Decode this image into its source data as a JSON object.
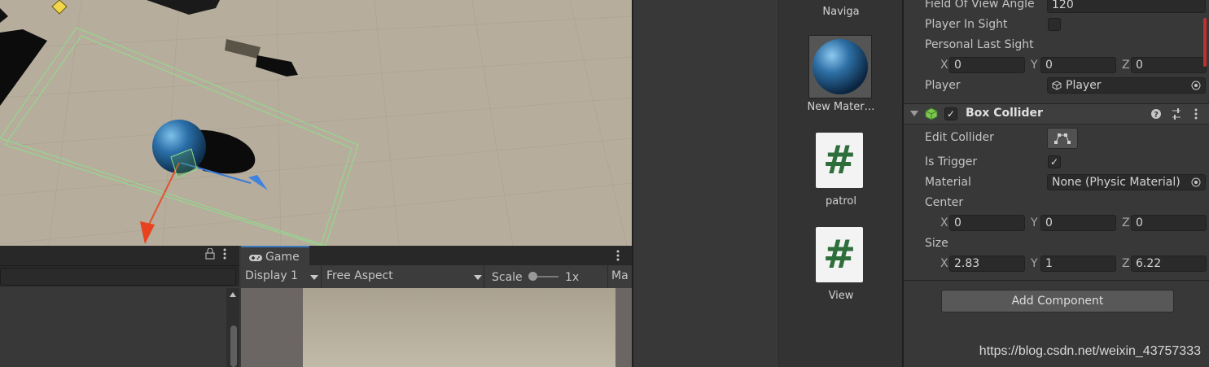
{
  "game_panel": {
    "tab_label": "Game",
    "display": "Display 1",
    "aspect": "Free Aspect",
    "scale_label": "Scale",
    "scale_value": "1x",
    "maximize_truncated": "Ma"
  },
  "project": {
    "assets": [
      {
        "name": "Naviga"
      },
      {
        "name": "New Mater…"
      },
      {
        "name": "patrol",
        "glyph": "#"
      },
      {
        "name": "View",
        "glyph": "#"
      }
    ]
  },
  "inspector": {
    "fov_label": "Field Of View Angle",
    "fov_value": "120",
    "player_in_sight_label": "Player In Sight",
    "personal_last_sight_label": "Personal Last Sight",
    "pls": {
      "x_label": "X",
      "x": "0",
      "y_label": "Y",
      "y": "0",
      "z_label": "Z",
      "z": "0"
    },
    "player_label": "Player",
    "player_value": "Player",
    "component_title": "Box Collider",
    "edit_collider_label": "Edit Collider",
    "is_trigger_label": "Is Trigger",
    "is_trigger_checked": true,
    "material_label": "Material",
    "material_value": "None (Physic Material)",
    "center_label": "Center",
    "center": {
      "x_label": "X",
      "x": "0",
      "y_label": "Y",
      "y": "0",
      "z_label": "Z",
      "z": "0"
    },
    "size_label": "Size",
    "size": {
      "x_label": "X",
      "x": "2.83",
      "y_label": "Y",
      "y": "1",
      "z_label": "Z",
      "z": "6.22"
    },
    "add_component": "Add Component",
    "check_glyph": "✓"
  },
  "watermark": "https://blog.csdn.net/weixin_43757333",
  "colors": {
    "scene_floor": "#b6ad9d",
    "bounds_green": "#8ee08a",
    "sphere_blue": "#2a6fa8",
    "script_green": "#2d6e3a"
  }
}
